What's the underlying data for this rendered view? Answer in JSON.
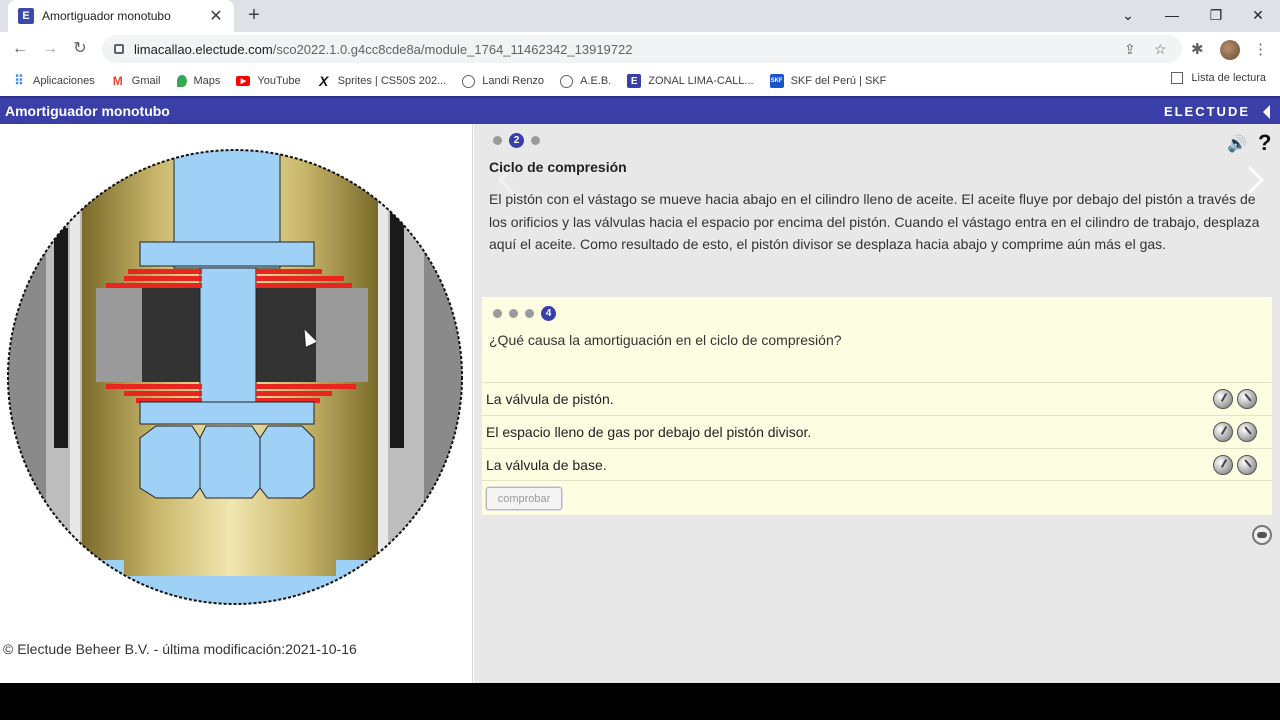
{
  "browser": {
    "tab_title": "Amortiguador monotubo",
    "tab_close": "✕",
    "new_tab": "+",
    "url_host": "limacallao.electude.com",
    "url_path": "/sco2022.1.0.g4cc8cde8a/module_1764_11462342_13919722",
    "bookmarks": [
      {
        "label": "Aplicaciones",
        "icon": "apps-grid-icon",
        "color": "#4285f4"
      },
      {
        "label": "Gmail",
        "icon": "gmail-icon",
        "color": "#ea4335"
      },
      {
        "label": "Maps",
        "icon": "maps-pin-icon",
        "color": "#34a853"
      },
      {
        "label": "YouTube",
        "icon": "youtube-icon",
        "color": "#ff0000"
      },
      {
        "label": "Sprites | CS50S 202...",
        "icon": "x-icon",
        "color": "#111111"
      },
      {
        "label": "Landi Renzo",
        "icon": "globe-icon",
        "color": "#5f6368"
      },
      {
        "label": "A.E.B.",
        "icon": "globe-icon",
        "color": "#5f6368"
      },
      {
        "label": "ZONAL LIMA-CALL...",
        "icon": "electude-icon",
        "color": "#3a3fa8"
      },
      {
        "label": "SKF del Perú | SKF",
        "icon": "skf-icon",
        "color": "#1a56c8"
      }
    ],
    "reading_list": "Lista de lectura"
  },
  "app": {
    "title": "Amortiguador monotubo",
    "brand": "ELECTUDE",
    "accent": "#3a3fa8"
  },
  "content": {
    "page_dots": [
      "",
      "2",
      ""
    ],
    "section_title": "Ciclo de compresión",
    "section_text": "El pistón con el vástago se mueve hacia abajo en el cilindro lleno de aceite. El aceite fluye por debajo del pistón a través de los orificios y las válvulas hacia el espacio por encima del pistón. Cuando el vástago entra en el cilindro de trabajo, desplaza aquí el aceite. Como resultado de esto, el pistón divisor se desplaza hacia abajo y comprime aún más el gas.",
    "speaker_icon": "🔊",
    "help_label": "?"
  },
  "quiz": {
    "dots": [
      "",
      "",
      "",
      "4"
    ],
    "question": "¿Qué causa la amortiguación en el ciclo de compresión?",
    "answers": [
      "La válvula de pistón.",
      "El espacio lleno de gas por debajo del pistón divisor.",
      "La válvula de base."
    ],
    "check_label": "comprobar"
  },
  "footer": {
    "copyright": "© Electude Beheer B.V. - última modificación:2021-10-16"
  }
}
